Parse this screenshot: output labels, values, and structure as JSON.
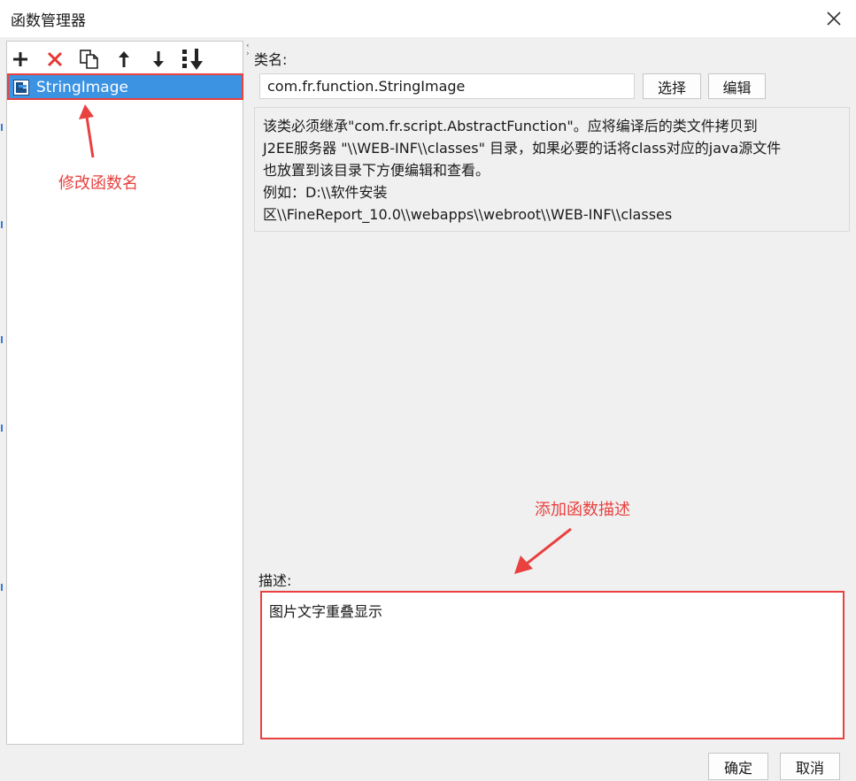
{
  "window": {
    "title": "函数管理器"
  },
  "toolbar": {
    "buttons": [
      {
        "icon": "plus-icon"
      },
      {
        "icon": "delete-icon"
      },
      {
        "icon": "copy-icon"
      },
      {
        "icon": "arrow-up-icon"
      },
      {
        "icon": "arrow-down-icon"
      },
      {
        "icon": "sort-icon"
      }
    ]
  },
  "tree": {
    "items": [
      {
        "label": "StringImage",
        "icon": "function-file-icon",
        "selected": true
      }
    ]
  },
  "class_name": {
    "label": "类名:",
    "value": "com.fr.function.StringImage",
    "select_button": "选择",
    "edit_button": "编辑"
  },
  "info": {
    "lines": [
      "该类必须继承\"com.fr.script.AbstractFunction\"。应将编译后的类文件拷贝到",
      "J2EE服务器 \"\\\\WEB-INF\\\\classes\" 目录，如果必要的话将class对应的java源文件",
      "也放置到该目录下方便编辑和查看。",
      "例如：D:\\\\软件安装",
      "区\\\\FineReport_10.0\\\\webapps\\\\webroot\\\\WEB-INF\\\\classes"
    ]
  },
  "description": {
    "label": "描述:",
    "value": "图片文字重叠显示"
  },
  "annotations": {
    "rename": "修改函数名",
    "add_description": "添加函数描述"
  },
  "footer": {
    "ok_button": "确定",
    "cancel_button": "取消"
  },
  "colors": {
    "selection": "#3c93e2",
    "annotation": "#e8413f",
    "dialog_bg": "#f0f0f0"
  }
}
